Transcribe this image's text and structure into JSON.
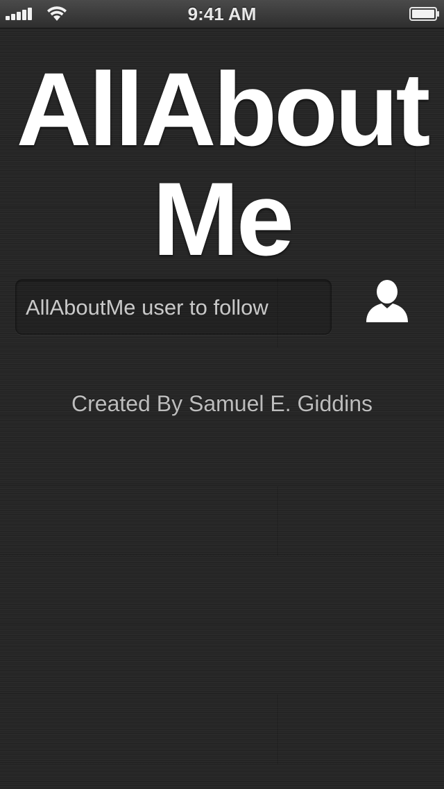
{
  "status_bar": {
    "time": "9:41 AM",
    "signal_icon": "signal-bars-icon",
    "wifi_icon": "wifi-icon",
    "battery_icon": "battery-icon"
  },
  "title": {
    "line1": "AllAbout",
    "line2": "Me"
  },
  "search": {
    "placeholder": "AllAboutMe user to follow",
    "value": ""
  },
  "user_button": {
    "icon": "user-silhouette-icon"
  },
  "credit": {
    "text": "Created By Samuel E. Giddins"
  },
  "colors": {
    "background": "#262626",
    "title": "#ffffff",
    "credit": "#bdbdbd"
  }
}
